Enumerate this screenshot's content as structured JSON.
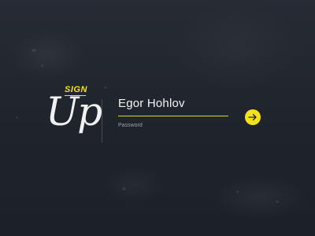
{
  "brand": {
    "sign_label": "SIGN",
    "up_label": "Up"
  },
  "form": {
    "name_value": "Egor Hohlov",
    "password_label": "Password",
    "submit_icon": "arrow-right-icon"
  },
  "colors": {
    "accent": "#f5e11a",
    "background": "#232831",
    "text": "#f4f4f4",
    "muted_text": "#9aa0a9"
  }
}
